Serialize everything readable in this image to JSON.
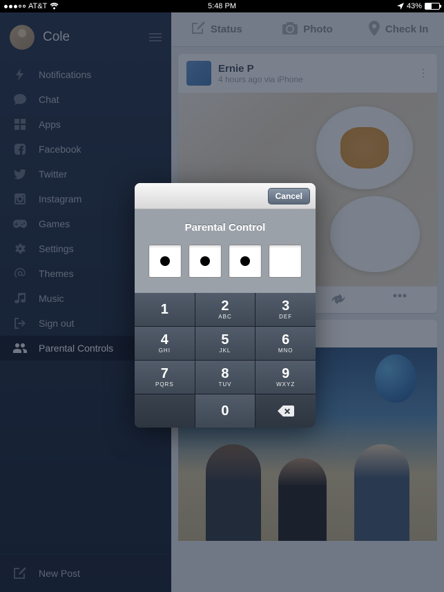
{
  "status_bar": {
    "carrier": "AT&T",
    "time": "5:48 PM",
    "battery_pct": "43%"
  },
  "sidebar": {
    "username": "Cole",
    "items": [
      {
        "label": "Notifications",
        "icon": "bolt-icon"
      },
      {
        "label": "Chat",
        "icon": "chat-icon"
      },
      {
        "label": "Apps",
        "icon": "apps-icon"
      },
      {
        "label": "Facebook",
        "icon": "facebook-icon"
      },
      {
        "label": "Twitter",
        "icon": "twitter-icon"
      },
      {
        "label": "Instagram",
        "icon": "instagram-icon"
      },
      {
        "label": "Games",
        "icon": "games-icon"
      },
      {
        "label": "Settings",
        "icon": "settings-icon"
      },
      {
        "label": "Themes",
        "icon": "themes-icon"
      },
      {
        "label": "Music",
        "icon": "music-icon"
      },
      {
        "label": "Sign out",
        "icon": "signout-icon"
      },
      {
        "label": "Parental Controls",
        "icon": "parental-icon"
      }
    ],
    "new_post": "New Post"
  },
  "actions": {
    "status": "Status",
    "photo": "Photo",
    "checkin": "Check In"
  },
  "post": {
    "name": "Ernie P",
    "meta": "4 hours ago via iPhone"
  },
  "modal": {
    "cancel": "Cancel",
    "title": "Parental Control",
    "pin_filled": 3,
    "keys": [
      {
        "num": "1",
        "letters": ""
      },
      {
        "num": "2",
        "letters": "ABC"
      },
      {
        "num": "3",
        "letters": "DEF"
      },
      {
        "num": "4",
        "letters": "GHI"
      },
      {
        "num": "5",
        "letters": "JKL"
      },
      {
        "num": "6",
        "letters": "MNO"
      },
      {
        "num": "7",
        "letters": "PQRS"
      },
      {
        "num": "8",
        "letters": "TUV"
      },
      {
        "num": "9",
        "letters": "WXYZ"
      },
      {
        "num": "0",
        "letters": ""
      }
    ]
  }
}
